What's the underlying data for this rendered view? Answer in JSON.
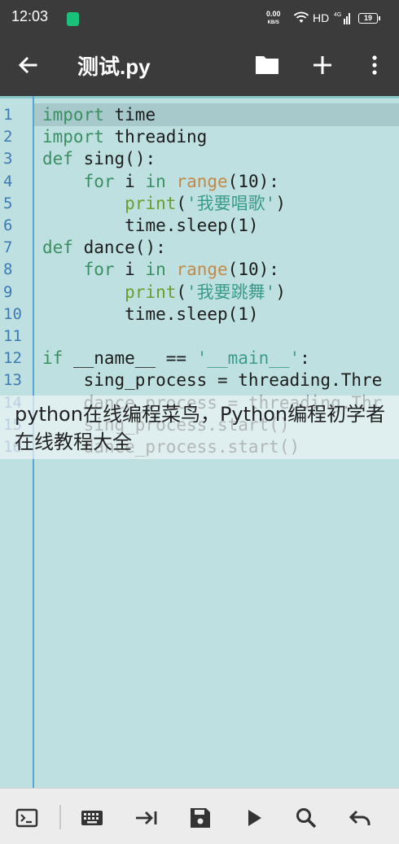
{
  "status_bar": {
    "time": "12:03",
    "speed_value": "0.00",
    "speed_unit": "KB/S",
    "network": "HD",
    "signal_label": "4G",
    "battery": "19"
  },
  "toolbar": {
    "title": "测试.py",
    "back_icon": "arrow-left-icon",
    "folder_icon": "folder-icon",
    "add_icon": "plus-icon",
    "more_icon": "more-vertical-icon"
  },
  "editor": {
    "lines": [
      {
        "n": "1",
        "text": "import time"
      },
      {
        "n": "2",
        "text": "import threading"
      },
      {
        "n": "3",
        "text": "def sing():"
      },
      {
        "n": "4",
        "text": "    for i in range(10):"
      },
      {
        "n": "5",
        "text": "        print('我要唱歌')"
      },
      {
        "n": "6",
        "text": "        time.sleep(1)"
      },
      {
        "n": "7",
        "text": "def dance():"
      },
      {
        "n": "8",
        "text": "    for i in range(10):"
      },
      {
        "n": "9",
        "text": "        print('我要跳舞')"
      },
      {
        "n": "10",
        "text": "        time.sleep(1)"
      },
      {
        "n": "11",
        "text": ""
      },
      {
        "n": "12",
        "text": "if __name__ == '__main__':"
      },
      {
        "n": "13",
        "text": "    sing_process = threading.Thre"
      },
      {
        "n": "14",
        "text": "    dance_process = threading.Thr"
      },
      {
        "n": "15",
        "text": "    sing_process.start()"
      },
      {
        "n": "16",
        "text": "    dance_process.start()"
      }
    ]
  },
  "watermark": {
    "text": "python在线编程菜鸟，Python编程初学者在线教程大全"
  },
  "bottom_bar": {
    "icons": [
      "terminal-icon",
      "keyboard-icon",
      "tab-indent-icon",
      "save-icon",
      "run-icon",
      "search-icon",
      "undo-icon"
    ]
  },
  "colors": {
    "toolbar_bg": "#3b3b3b",
    "editor_bg": "#bfe0e0",
    "keyword": "#3a8f62",
    "builtin": "#c18a4a",
    "print": "#6b9e2e",
    "string": "#3a9b8c",
    "line_number": "#3d7ab3"
  }
}
